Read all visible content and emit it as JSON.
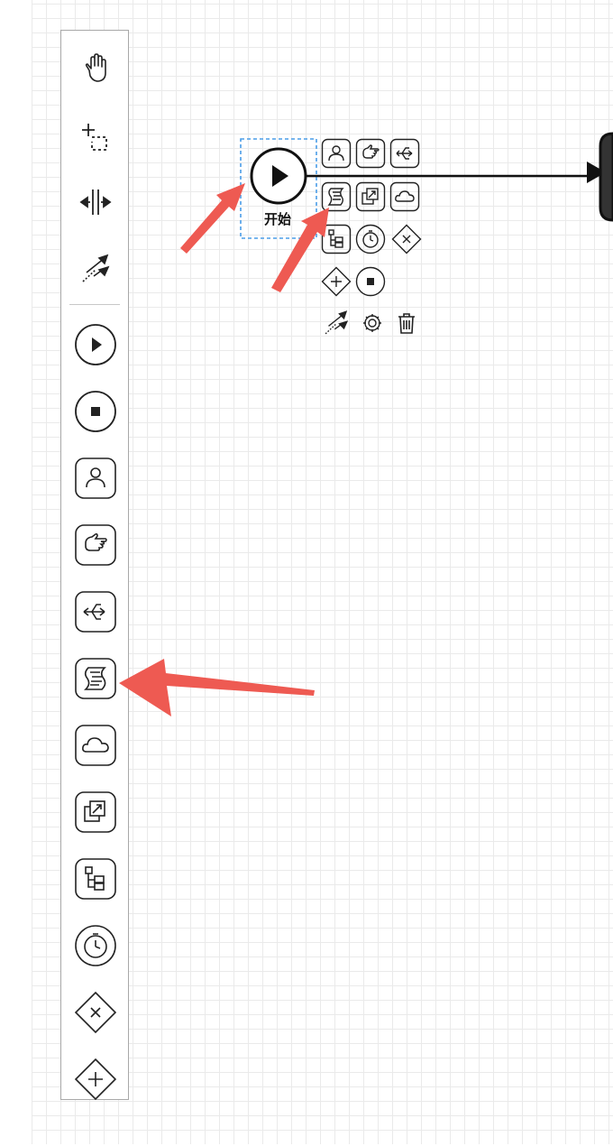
{
  "canvas": {
    "grid_color": "#eaeaea",
    "start_event": {
      "label": "开始"
    }
  },
  "palette": {
    "tools": [
      {
        "name": "hand-tool",
        "icon": "hand-icon"
      },
      {
        "name": "lasso-tool",
        "icon": "lasso-icon"
      },
      {
        "name": "space-tool",
        "icon": "space-icon"
      },
      {
        "name": "global-connect-tool",
        "icon": "connect-icon"
      }
    ],
    "elements": [
      {
        "name": "start-event",
        "icon": "start-event-icon"
      },
      {
        "name": "end-event",
        "icon": "end-event-icon"
      },
      {
        "name": "user-task",
        "icon": "user-task-icon"
      },
      {
        "name": "manual-task",
        "icon": "manual-task-icon"
      },
      {
        "name": "service-task",
        "icon": "service-task-icon"
      },
      {
        "name": "script-task",
        "icon": "script-task-icon"
      },
      {
        "name": "subprocess-cloud",
        "icon": "cloud-icon"
      },
      {
        "name": "call-activity",
        "icon": "call-activity-icon"
      },
      {
        "name": "subprocess",
        "icon": "subprocess-icon"
      },
      {
        "name": "timer-event",
        "icon": "timer-icon"
      },
      {
        "name": "exclusive-gateway",
        "icon": "exclusive-gateway-icon"
      },
      {
        "name": "parallel-gateway",
        "icon": "parallel-gateway-icon"
      }
    ]
  },
  "context_pad": {
    "items": [
      "user-task-icon",
      "manual-task-icon",
      "service-task-icon",
      "script-task-icon",
      "call-activity-icon",
      "cloud-icon",
      "subprocess-icon",
      "timer-icon",
      "exclusive-gateway-icon",
      "parallel-gateway-icon",
      "end-event-icon",
      "connect-icon",
      "gear-icon",
      "trash-icon"
    ]
  },
  "annotations": {
    "arrow_color": "#ee5a52"
  }
}
